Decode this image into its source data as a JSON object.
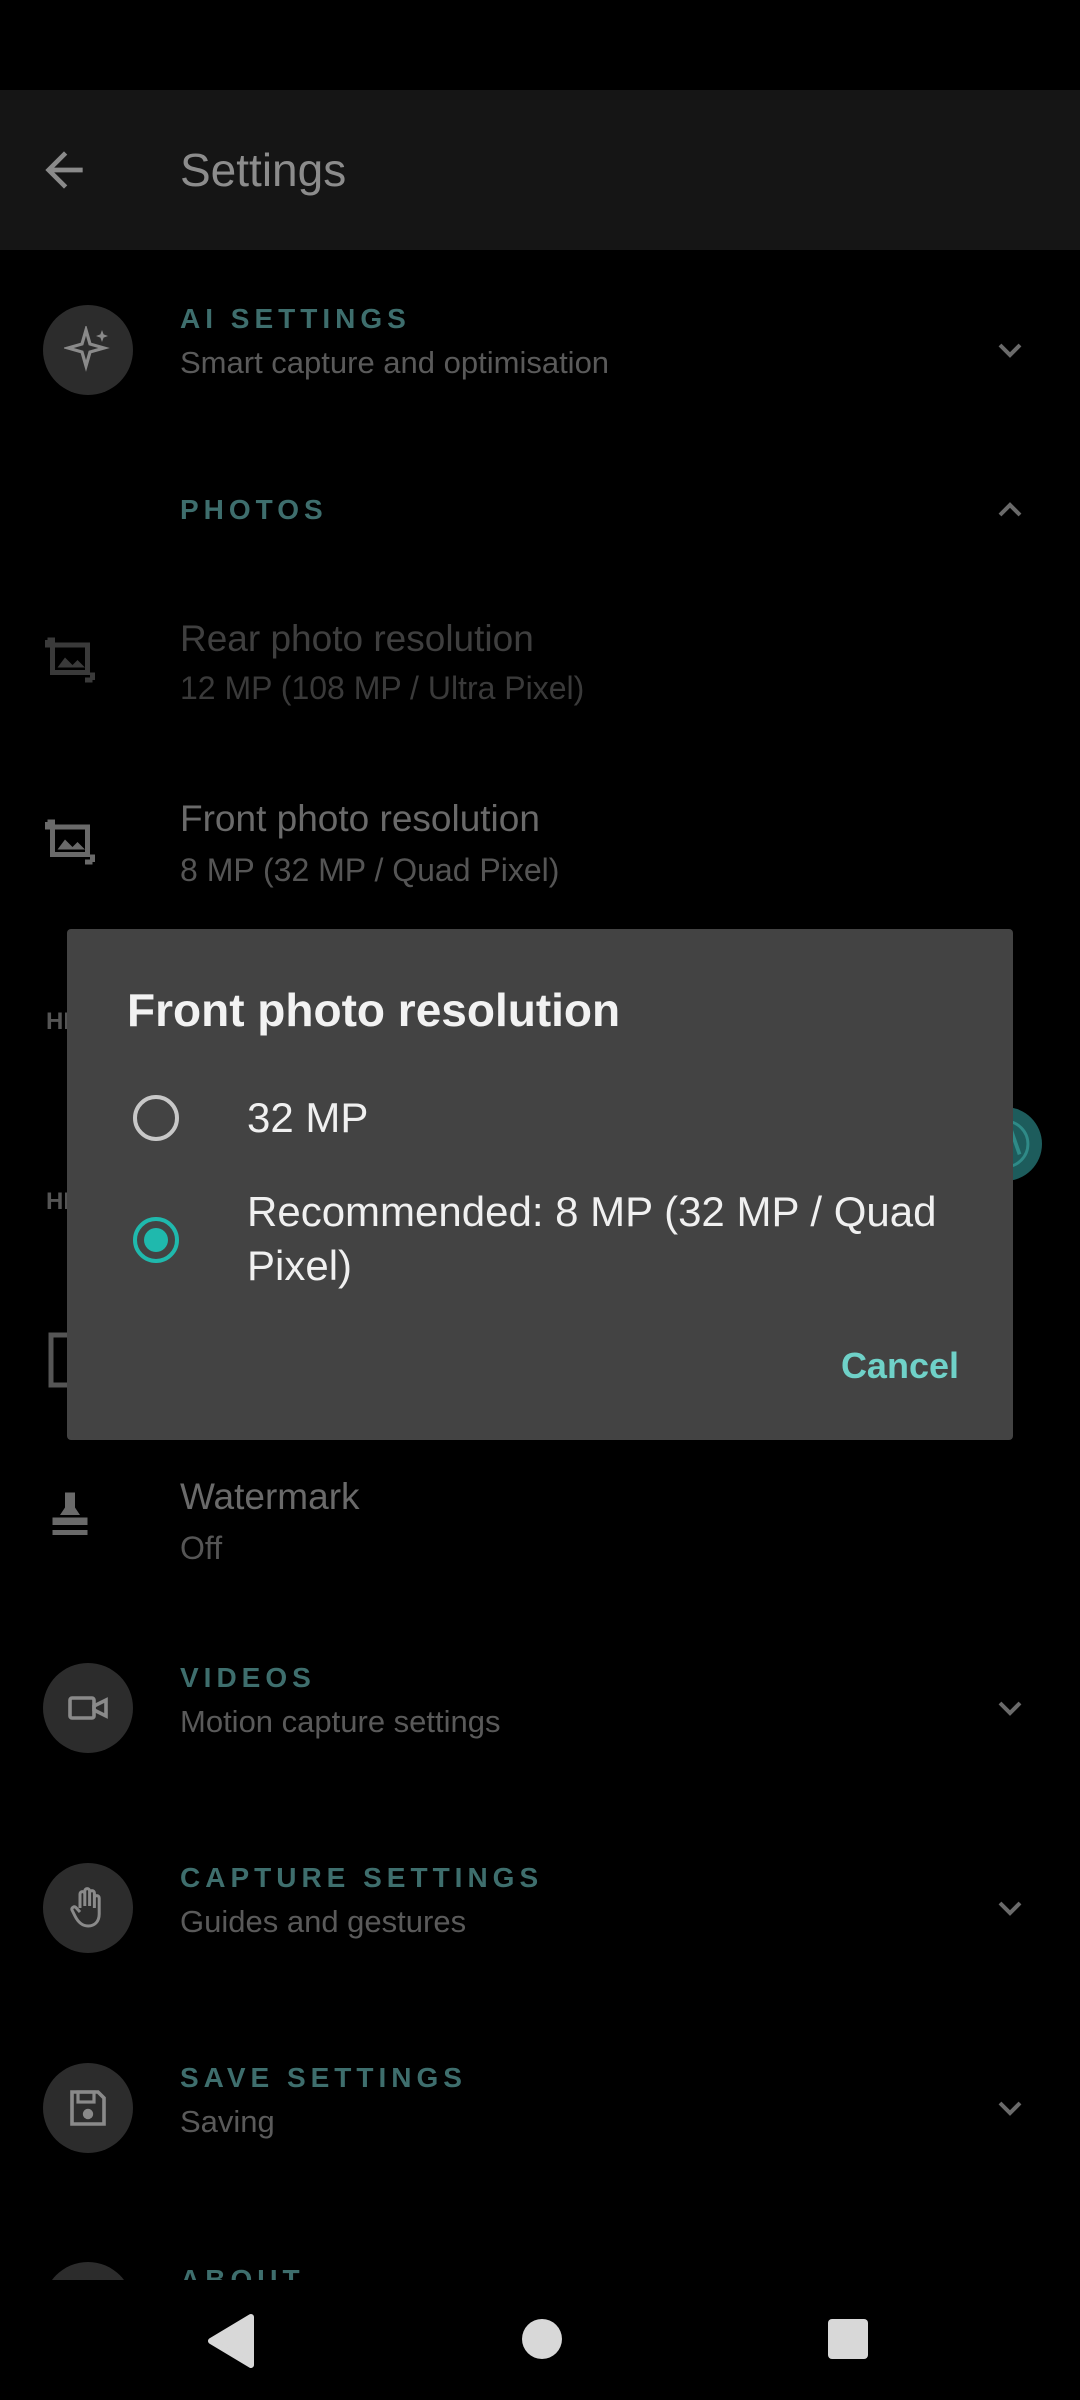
{
  "appbar": {
    "title": "Settings"
  },
  "sections": {
    "ai": {
      "title": "AI SETTINGS",
      "subtitle": "Smart capture and optimisation"
    },
    "photos": {
      "title": "PHOTOS"
    },
    "videos": {
      "title": "VIDEOS",
      "subtitle": "Motion capture settings"
    },
    "capture": {
      "title": "CAPTURE SETTINGS",
      "subtitle": "Guides and gestures"
    },
    "save": {
      "title": "SAVE SETTINGS",
      "subtitle": "Saving"
    },
    "about": {
      "title": "ABOUT"
    }
  },
  "rows": {
    "rear": {
      "title": "Rear photo resolution",
      "subtitle": "12 MP (108 MP / Ultra Pixel)"
    },
    "front": {
      "title": "Front photo resolution",
      "subtitle": "8 MP (32 MP / Quad Pixel)"
    },
    "hdr1": "HI",
    "hdr2": "HI",
    "watermark": {
      "title": "Watermark",
      "subtitle": "Off"
    }
  },
  "dialog": {
    "title": "Front photo resolution",
    "options": [
      {
        "label": "32 MP",
        "selected": false
      },
      {
        "label": "Recommended: 8 MP (32 MP / Quad Pixel)",
        "selected": true
      }
    ],
    "cancel_label": "Cancel"
  },
  "colors": {
    "accent": "#1fb9ad",
    "dialog_bg": "#434343",
    "section_title": "#3e6e6d"
  }
}
